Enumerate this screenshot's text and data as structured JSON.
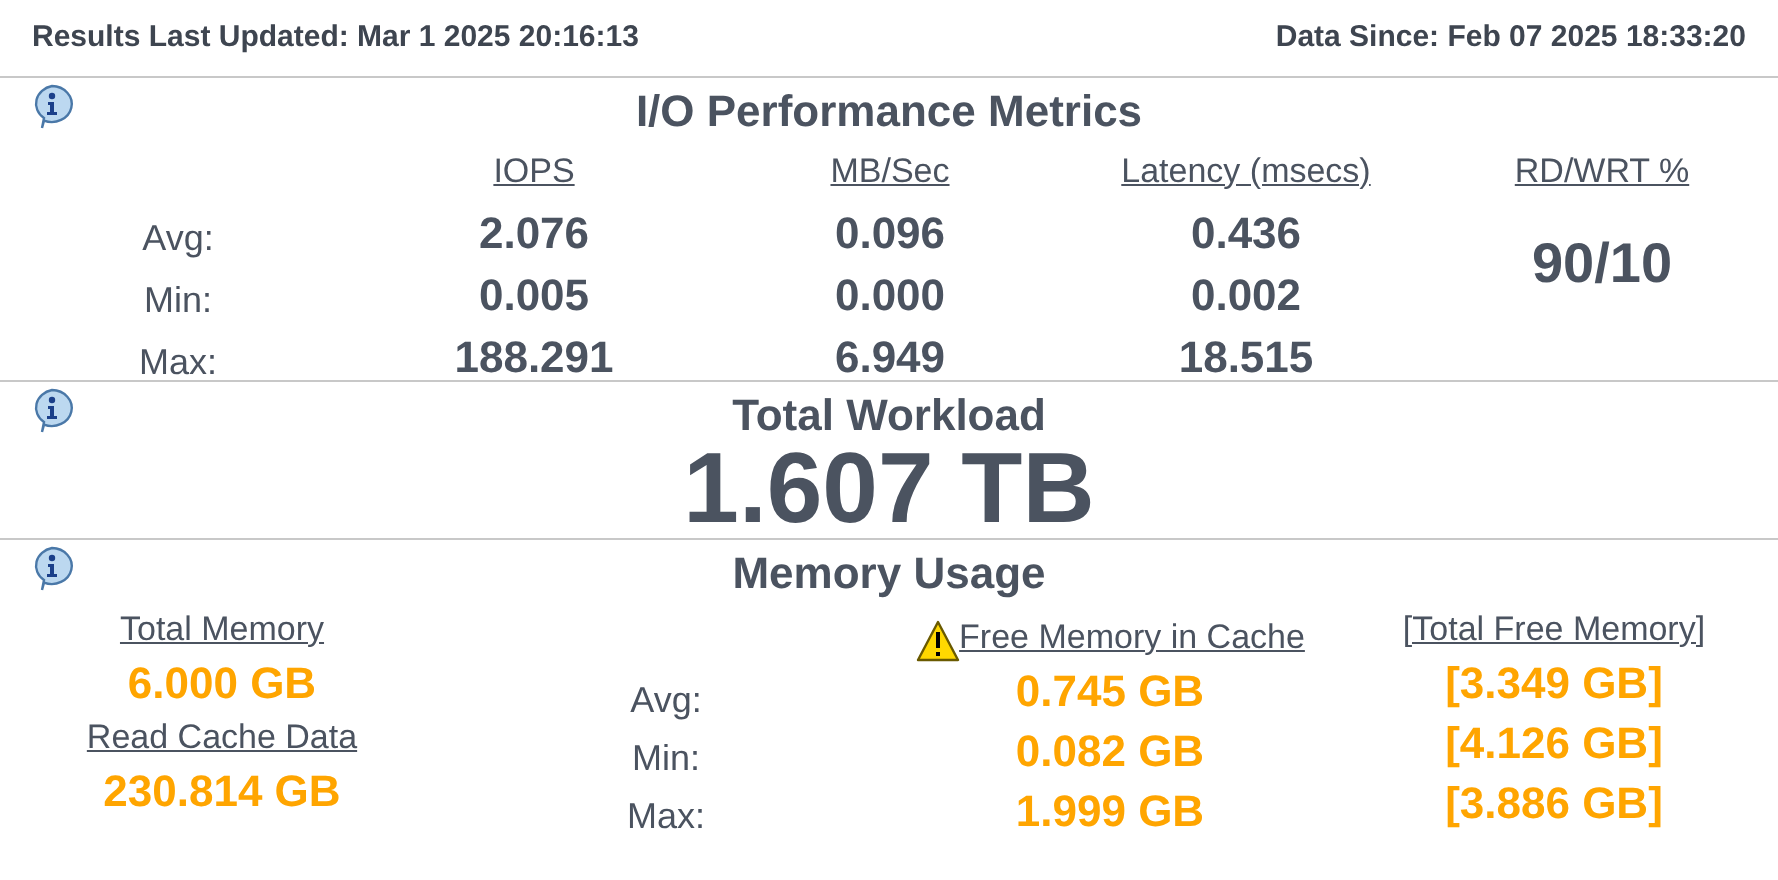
{
  "header": {
    "last_updated": "Results Last Updated: Mar 1 2025 20:16:13",
    "data_since": "Data Since: Feb 07 2025 18:33:20"
  },
  "io_metrics": {
    "title": "I/O Performance Metrics",
    "columns": [
      "IOPS",
      "MB/Sec",
      "Latency (msecs)"
    ],
    "rd_wrt_label": "RD/WRT %",
    "rd_wrt": "90/10",
    "rows": [
      {
        "label": "Avg:",
        "values": [
          "2.076",
          "0.096",
          "0.436"
        ]
      },
      {
        "label": "Min:",
        "values": [
          "0.005",
          "0.000",
          "0.002"
        ]
      },
      {
        "label": "Max:",
        "values": [
          "188.291",
          "6.949",
          "18.515"
        ]
      }
    ]
  },
  "workload": {
    "title": "Total Workload",
    "value": "1.607 TB"
  },
  "memory": {
    "title": "Memory Usage",
    "total_memory_label": "Total Memory",
    "total_memory": "6.000 GB",
    "read_cache_label": "Read Cache Data",
    "read_cache": "230.814 GB",
    "free_cache_label": "Free Memory in Cache",
    "total_free_label": "[Total Free Memory]",
    "rows": [
      {
        "label": "Avg:",
        "free": "0.745 GB",
        "total_free": "[3.349 GB]"
      },
      {
        "label": "Min:",
        "free": "0.082 GB",
        "total_free": "[4.126 GB]"
      },
      {
        "label": "Max:",
        "free": "1.999 GB",
        "total_free": "[3.886 GB]"
      }
    ]
  }
}
